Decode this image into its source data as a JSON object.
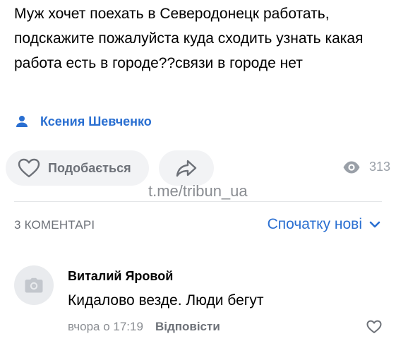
{
  "post": {
    "text": "Муж хочет поехать в Северодонецк работать, подскажите пожалуйста куда сходить узнать какая работа есть в городе??связи в городе нет",
    "author": "Ксения Шевченко"
  },
  "actions": {
    "like_label": "Подобається",
    "views_count": "313"
  },
  "watermark": "t.me/tribun_ua",
  "comments_section": {
    "count_label": "3 КОМЕНТАРІ",
    "sort_label": "Спочатку нові"
  },
  "comments": [
    {
      "author": "Виталий Яровой",
      "text": "Кидалово везде. Люди бегут",
      "time": "вчора о 17:19",
      "reply_label": "Відповісти"
    }
  ],
  "colors": {
    "accent": "#2a6fd1",
    "muted": "#6d7178",
    "button_bg": "#f2f3f5"
  },
  "icons": [
    "person-icon",
    "heart-icon",
    "share-icon",
    "eye-icon",
    "chevron-down-icon",
    "camera-icon"
  ]
}
